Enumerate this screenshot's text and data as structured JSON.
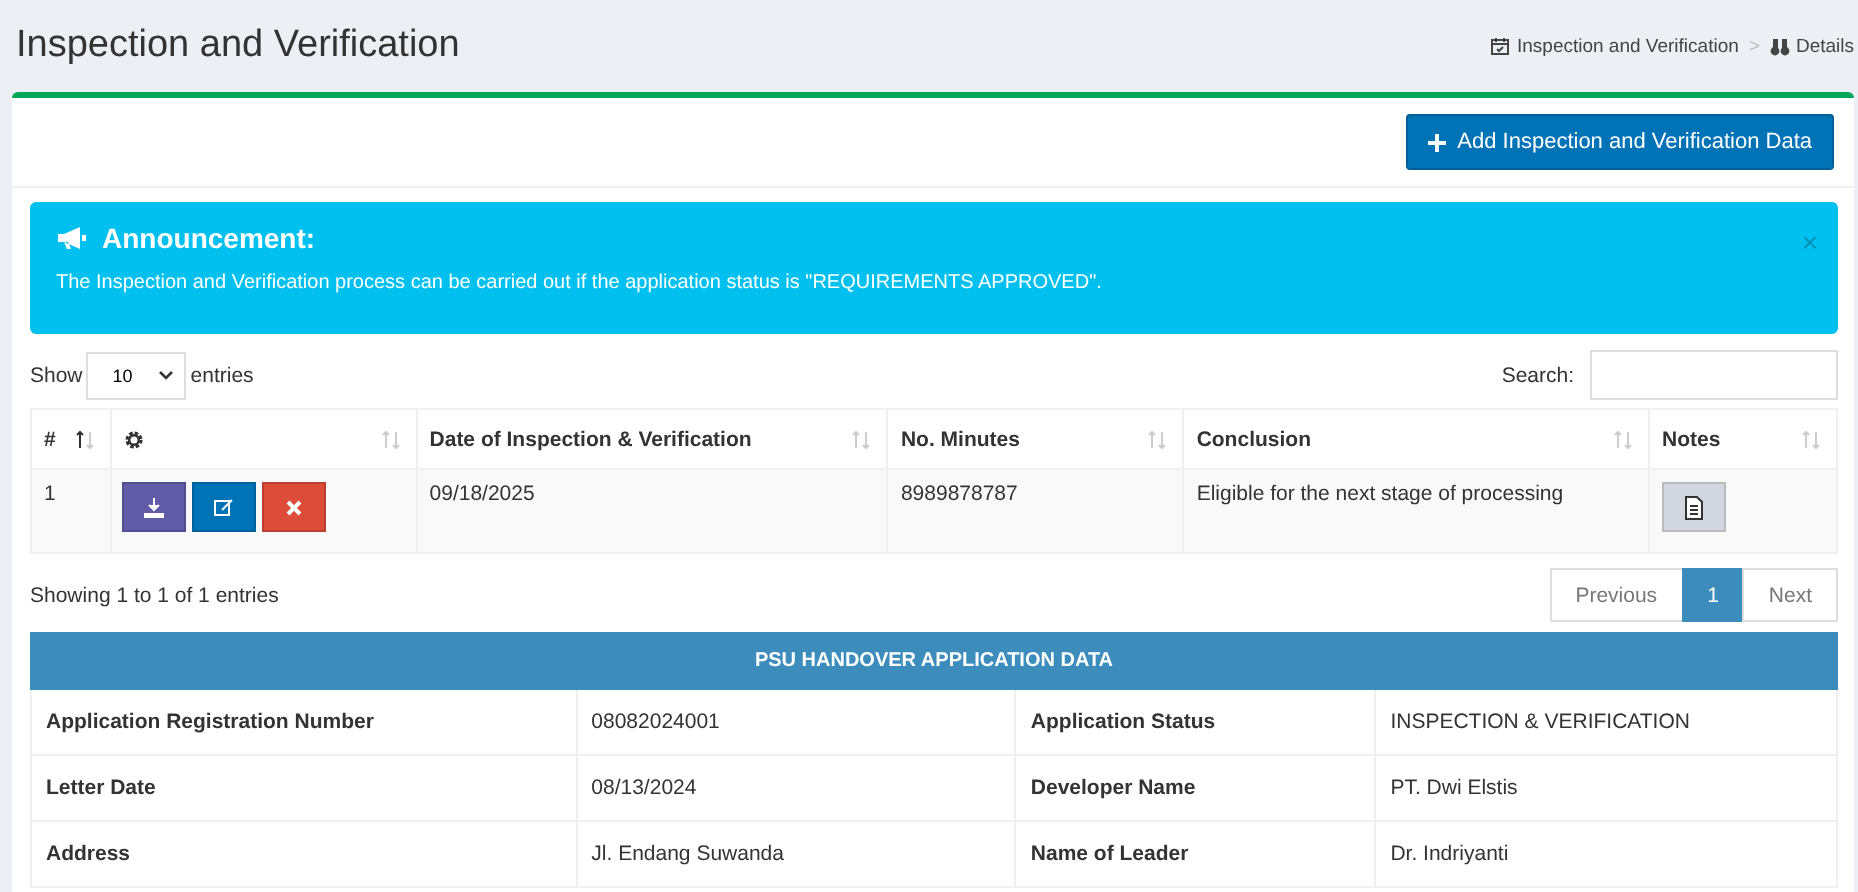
{
  "page": {
    "title": "Inspection and Verification"
  },
  "breadcrumb": [
    {
      "label": "Inspection and Verification",
      "kind": "calendar"
    },
    {
      "label": "Details",
      "kind": "binoculars"
    }
  ],
  "breadcrumb_separator": ">",
  "add_button": {
    "label": "Add Inspection and Verification Data"
  },
  "announcement": {
    "title": "Announcement:",
    "text": "The Inspection and Verification process can be carried out if the application status is \"REQUIREMENTS APPROVED\".",
    "close": "×"
  },
  "length_menu": {
    "before": "Show",
    "value": "10",
    "after": "entries"
  },
  "search": {
    "label": "Search:"
  },
  "table": {
    "columns": [
      {
        "label": "#",
        "kind": "text",
        "selected": true
      },
      {
        "kind": "gear",
        "selected": false
      },
      {
        "label": "Date of Inspection & Verification",
        "kind": "text",
        "selected": false
      },
      {
        "label": "No. Minutes",
        "kind": "text",
        "selected": false
      },
      {
        "label": "Conclusion",
        "kind": "text",
        "selected": false
      },
      {
        "label": "Notes",
        "kind": "text",
        "selected": false
      }
    ],
    "rows": [
      {
        "number": "1",
        "actions": [
          {
            "kind": "download"
          },
          {
            "kind": "edit"
          },
          {
            "kind": "delete"
          }
        ],
        "date": "09/18/2025",
        "minutes": "8989878787",
        "conclusion": "Eligible for the next stage of processing"
      }
    ]
  },
  "info": "Showing 1 to 1 of 1 entries",
  "pagination": [
    {
      "label": "Previous",
      "selected": false,
      "disabled": true
    },
    {
      "label": "1",
      "selected": true,
      "disabled": false
    },
    {
      "label": "Next",
      "selected": false,
      "disabled": true
    }
  ],
  "application": {
    "title": "PSU HANDOVER APPLICATION DATA",
    "rows": [
      [
        "Application Registration Number",
        "08082024001",
        "Application Status",
        "INSPECTION & VERIFICATION"
      ],
      [
        "Letter Date",
        "08/13/2024",
        "Developer Name",
        "PT. Dwi Elstis"
      ],
      [
        "Address",
        "Jl. Endang Suwanda",
        "Name of Leader",
        "Dr. Indriyanti"
      ]
    ]
  }
}
